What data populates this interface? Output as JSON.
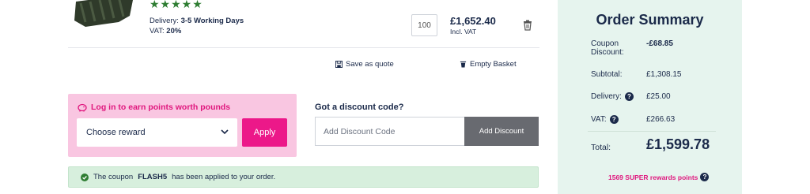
{
  "product": {
    "rating_stars": "★★★★★",
    "delivery_label": "Delivery:",
    "delivery_value": "3-5 Working Days",
    "vat_label": "VAT:",
    "vat_value": "20%",
    "quantity": "100",
    "price": "£1,652.40",
    "price_note": "Incl. VAT"
  },
  "actions": {
    "save_quote": "Save as quote",
    "empty_basket": "Empty Basket"
  },
  "rewards": {
    "title": "Log in to earn points worth pounds",
    "select_value": "Choose reward",
    "apply": "Apply"
  },
  "discount": {
    "title": "Got a discount code?",
    "placeholder": "Add Discount Code",
    "button": "Add Discount"
  },
  "coupon": {
    "prefix": "The coupon",
    "code": "FLASH5",
    "suffix": "has been applied to your order."
  },
  "summary": {
    "title": "Order Summary",
    "coupon_label_1": "Coupon",
    "coupon_label_2": "Discount:",
    "coupon_value": "-£68.85",
    "subtotal_label": "Subtotal:",
    "subtotal_value": "£1,308.15",
    "delivery_label": "Delivery:",
    "delivery_value": "£25.00",
    "vat_label": "VAT:",
    "vat_value": "£266.63",
    "total_label": "Total:",
    "total_value": "£1,599.78",
    "points": "1569 SUPER rewards points",
    "help_glyph": "?"
  },
  "colors": {
    "brand_pink": "#ec1889",
    "navy": "#1b2a4a",
    "summary_bg": "#e6f4ee",
    "success_bg": "#d7efdd"
  }
}
